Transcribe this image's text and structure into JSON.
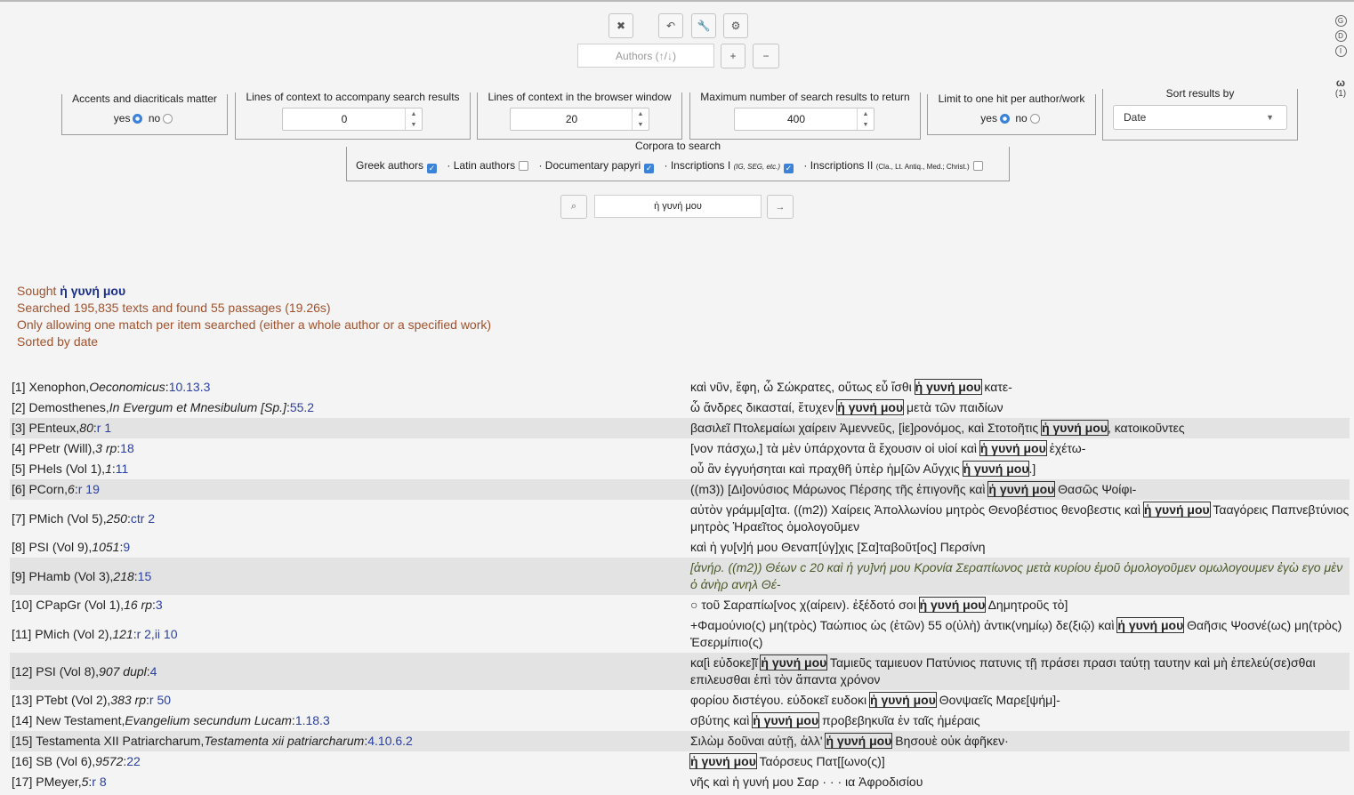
{
  "toolbar": {
    "buttons": [
      {
        "name": "clear-button",
        "glyph": "✖"
      },
      {
        "name": "undo-button",
        "glyph": "↶"
      },
      {
        "name": "tools-button",
        "glyph": "🔧"
      },
      {
        "name": "settings-button",
        "glyph": "⚙"
      }
    ],
    "authors_placeholder": "Authors (↑/↓)",
    "plus_label": "+",
    "minus_label": "−"
  },
  "side": {
    "icons": [
      "G",
      "D",
      "I"
    ],
    "omega": "ω",
    "count": "(1)"
  },
  "options": {
    "accents": {
      "legend": "Accents and diacriticals matter",
      "yes": "yes",
      "no": "no",
      "selected": "yes"
    },
    "lines_context": {
      "legend": "Lines of context to accompany search results",
      "value": "0"
    },
    "lines_browser": {
      "legend": "Lines of context in the browser window",
      "value": "20"
    },
    "max_results": {
      "legend": "Maximum number of search results to return",
      "value": "400"
    },
    "one_hit": {
      "legend": "Limit to one hit per author/work",
      "yes": "yes",
      "no": "no",
      "selected": "yes"
    },
    "sort": {
      "legend": "Sort results by",
      "value": "Date"
    }
  },
  "corpora": {
    "legend": "Corpora to search",
    "items": [
      {
        "label": "Greek authors",
        "checked": true
      },
      {
        "label": "· Latin authors",
        "checked": false
      },
      {
        "label": "· Documentary papyri",
        "checked": true
      },
      {
        "label": "· Inscriptions I",
        "note": "(IG, SEG, etc.)",
        "checked": true
      },
      {
        "label": "· Inscriptions II",
        "note": "(Cla., Lt. Antiq., Med.; Christ.)",
        "checked": false
      }
    ]
  },
  "search": {
    "query": "ἡ γυνή μου",
    "search_icon": "⌕",
    "go_icon": "→"
  },
  "summary": {
    "sought_label": "Sought",
    "sought_term": "ἡ γυνή μου",
    "line2": "Searched 195,835 texts and found 55 passages (19.26s)",
    "line3": "Only allowing one match per item searched (either a whole author or a specified work)",
    "line4": "Sorted by date"
  },
  "results": [
    {
      "num": "[1]",
      "author": "Xenophon, ",
      "work": "Oeconomicus",
      "sep": ": ",
      "ref": "10.13.3",
      "pre": "καὶ νῦν, ἔφη, ὦ Σώκρατες, οὕτως εὖ ἴσθι ",
      "hit": "ἡ γυνή μου",
      "post": " κατε-"
    },
    {
      "num": "[2]",
      "author": "Demosthenes, ",
      "work": "In Evergum et Mnesibulum [Sp.]",
      "sep": ": ",
      "ref": "55.2",
      "pre": "ὦ ἄνδρες δικασταί, ἔτυχεν ",
      "hit": "ἡ γυνή μου",
      "post": " μετὰ τῶν παιδίων"
    },
    {
      "num": "[3]",
      "author": "PEnteux, ",
      "work": "80",
      "sep": ": ",
      "ref": "r 1",
      "pre": "βασιλεῖ Πτολεμαίωι χαίρειν Ἀμεννεῦς, [ἱε]ρονόμος, καὶ Στοτοῆτις ",
      "hit": "ἡ γυνή μου",
      "post": ", κατοικοῦντες"
    },
    {
      "num": "[4]",
      "author": "PPetr (Will), ",
      "work": "3 rp",
      "sep": ": ",
      "ref": "18",
      "pre": "[νον πάσχω,] τὰ μὲν ὑπάρχοντα ἃ ἔχουσιν οἱ υἱοί καὶ ",
      "hit": "ἡ γυνή μου",
      "post": " ἐχέτω-"
    },
    {
      "num": "[5]",
      "author": "PHels (Vol 1), ",
      "work": "1",
      "sep": ": ",
      "ref": "11",
      "pre": "οὗ ἂν ἐγγυήσηται καὶ πραχθῆ ὑπὲρ ἡμ[ῶν Αὔγχις ",
      "hit": "ἡ γυνή μου",
      "post": ".]"
    },
    {
      "num": "[6]",
      "author": "PCorn, ",
      "work": "6",
      "sep": ": ",
      "ref": "r 19",
      "pre": "((m3)) [Δι]ονύσιος Μάρωνος Πέρσης τῆς ἐπιγονῆς καὶ ",
      "hit": "ἡ γυνή μου",
      "post": " Θασῶς Ψοίφι-"
    },
    {
      "num": "[7]",
      "author": "PMich (Vol 5), ",
      "work": "250",
      "sep": ": ",
      "ref": "ctr 2",
      "pre": "αὐτὸν γράμμ[α]τα. ((m2)) Χαίρεις Ἀπολλωνίου μητρὸς Θενοβέστιος θενοβεστις καὶ ",
      "hit": "ἡ γυνή μου",
      "post": " Τααγόρεις Παπνεβτύνιος μητρὸς Ἡραεῖτος ὁμολογοῦμεν"
    },
    {
      "num": "[8]",
      "author": "PSI (Vol 9), ",
      "work": "1051",
      "sep": ": ",
      "ref": "9",
      "pre": "καὶ ἡ γυ[ν]ή μου Θεναπ[ύγ]χις [Σα]ταβοῦτ[ος] Περσίνη",
      "hit": "",
      "post": ""
    },
    {
      "num": "[9]",
      "author": "PHamb (Vol 3), ",
      "work": "218",
      "sep": ": ",
      "ref": "15",
      "pre": "[ἀνήρ. ((m2)) Θέων c 20 καὶ ἡ γυ]νή μου Κρονία Σεραπίωνος μετὰ κυρίου ἐμοῦ ὁμολογοῦμεν ομωλογουμεν ἐγὼ εγο μὲν ὁ ἀνὴρ ανηλ Θέ-",
      "hit": "",
      "post": ""
    },
    {
      "num": "[10]",
      "author": "CPapGr (Vol 1), ",
      "work": "16 rp",
      "sep": ": ",
      "ref": "3",
      "pre": "○ τοῦ Σαραπίω[νος χ(αίρειν). ἐξέδοτό σοι ",
      "hit": "ἡ γυνή μου",
      "post": " Δημητροῦς τὸ]"
    },
    {
      "num": "[11]",
      "author": "PMich (Vol 2), ",
      "work": "121",
      "sep": ": ",
      "ref": "r 2,ii 10",
      "pre": "+Φαμούνιο(ς) μη(τρὸς) Ταώπιος ὡς (ἐτῶν) 55 ο(ὐλὴ) ἀντικ(νημίῳ) δε(ξιῷ) καὶ ",
      "hit": "ἡ γυνή μου",
      "post": " Θαῆσις Ψοσνέ(ως) μη(τρὸς) Ἐσερμίπιο(ς)"
    },
    {
      "num": "[12]",
      "author": "PSI (Vol 8), ",
      "work": "907 dupl",
      "sep": ": ",
      "ref": "4",
      "pre": "κα[ὶ εὐδοκε]ῖ ",
      "hit": "ἡ γυνή μου",
      "post": " Ταμιεῦς ταμιευον Πατύνιος πατυνις τῇ πράσει πρασι ταύτῃ ταυτην καὶ μὴ ἐπελεύ(σε)σθαι επιλευσθαι ἐπὶ τὸν ἅπαντα χρόνον"
    },
    {
      "num": "[13]",
      "author": "PTebt (Vol 2), ",
      "work": "383 rp",
      "sep": ": ",
      "ref": "r 50",
      "pre": "φορίου διστέγου. εὐδοκεῖ ευδοκι ",
      "hit": "ἡ γυνή μου",
      "post": " Θονψαεῖς Μαρε[ψήμ]-"
    },
    {
      "num": "[14]",
      "author": "New Testament, ",
      "work": "Evangelium secundum Lucam",
      "sep": ": ",
      "ref": "1.18.3",
      "pre": "σβύτης καὶ ",
      "hit": "ἡ γυνή μου",
      "post": " προβεβηκυῖα ἐν ταῖς ἡμέραις"
    },
    {
      "num": "[15]",
      "author": "Testamenta XII Patriarcharum, ",
      "work": "Testamenta xii patriarcharum",
      "sep": ": ",
      "ref": "4.10.6.2",
      "pre": "Σιλὼμ δοῦναι αὐτῇ, ἀλλ' ",
      "hit": "ἡ γυνή μου",
      "post": " Βησουὲ οὐκ ἀφῆκεν·"
    },
    {
      "num": "[16]",
      "author": "SB (Vol 6), ",
      "work": "9572",
      "sep": ": ",
      "ref": "22",
      "pre": "",
      "hit": "ἡ γυνή μου",
      "post": " Ταόρσευς Πατ[[ωνο(ς)]"
    },
    {
      "num": "[17]",
      "author": "PMeyer, ",
      "work": "5",
      "sep": ": ",
      "ref": "r 8",
      "pre": "νῆς καὶ ἡ γυνή μου Σαρ · · · ια Ἀφροδισίου",
      "hit": "",
      "post": ""
    }
  ]
}
